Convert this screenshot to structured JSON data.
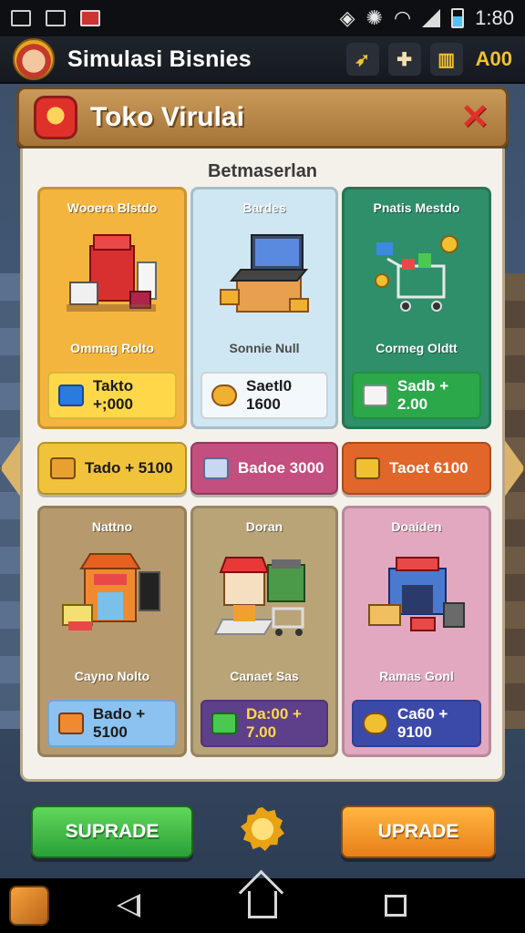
{
  "status_bar": {
    "time": "1:80"
  },
  "top_bar": {
    "app_title": "Simulasi Bisnies",
    "currency_value": "A00"
  },
  "panel": {
    "title": "Toko Virulai",
    "section_title": "Betmaserlan"
  },
  "cards": [
    {
      "name": "Wooera Blstdo",
      "sub": "Ommag Rolto",
      "price": "Takto +;000",
      "bg": "#f4b53e",
      "pill_bg": "#ffd84a",
      "pill_text": "#1a1a1a",
      "icon": "cash-register-icon"
    },
    {
      "name": "Bardes",
      "sub": "Sonnie Null",
      "price": "Saetl0 1600",
      "bg": "#cfe7f2",
      "pill_bg": "#f2f8fb",
      "pill_text": "#1a1a1a",
      "icon": "laptop-icon"
    },
    {
      "name": "Pnatis Mestdo",
      "sub": "Cormeg Oldtt",
      "price": "Sadb + 2.00",
      "bg": "#2f8f6a",
      "pill_bg": "#2aa84a",
      "pill_text": "#ffffff",
      "icon": "shopping-cart-icon"
    },
    {
      "name": "Nattno",
      "sub": "Cayno Nolto",
      "price": "Bado + 5100",
      "bg": "#b69a6e",
      "pill_bg": "#8cc2ef",
      "pill_text": "#1a1a1a",
      "icon": "storefront-icon"
    },
    {
      "name": "Doran",
      "sub": "Canaet Sas",
      "price": "Da:00 + 7.00",
      "bg": "#b9a478",
      "pill_bg": "#5e3f8a",
      "pill_text": "#ffd84a",
      "icon": "market-stall-icon"
    },
    {
      "name": "Doaiden",
      "sub": "Ramas Gonl",
      "price": "Ca60 + 9100",
      "bg": "#e2a8c0",
      "pill_bg": "#3b4aa8",
      "pill_text": "#ffffff",
      "icon": "warehouse-icon"
    }
  ],
  "mid_buttons": [
    {
      "label": "Tado + 5100",
      "bg": "#f1c33a",
      "text": "#1a1a1a"
    },
    {
      "label": "Badoe 3000",
      "bg": "#c24f7d",
      "text": "#ffffff"
    },
    {
      "label": "Taoet 6100",
      "bg": "#e0662a",
      "text": "#ffffff"
    }
  ],
  "bottom": {
    "left_label": "SUPRADE",
    "right_label": "UPRADE"
  }
}
